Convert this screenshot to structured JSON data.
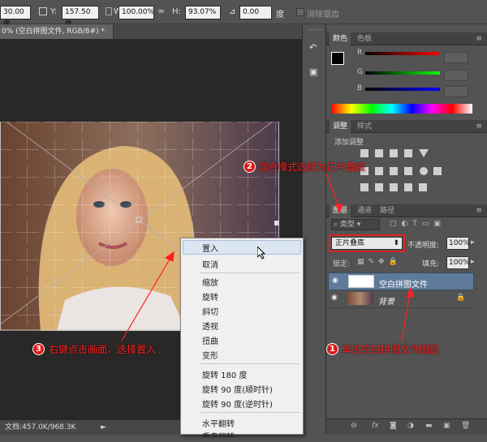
{
  "options_bar": {
    "x_value": "30.00 像",
    "y_label": "Y:",
    "y_value": "157.50 像",
    "w_label": "W:",
    "w_value": "100.00%",
    "h_label": "H:",
    "h_value": "93.07%",
    "angle_value": "0.00",
    "angle_unit": "度",
    "antialias_label": "消除锯齿"
  },
  "document": {
    "tab_title": "0% (空白拼图文件, RGB/8#) *",
    "close_glyph": "×",
    "status_text": "文档:457.0K/968.3K"
  },
  "color_panel": {
    "tabs": [
      "颜色",
      "色板"
    ],
    "channels": [
      "R",
      "G",
      "B"
    ]
  },
  "adjust_panel": {
    "tabs": [
      "调整",
      "样式"
    ],
    "add_label": "添加调整"
  },
  "layers_panel": {
    "tabs": [
      "图层",
      "通道",
      "路径"
    ],
    "kind_label": "类型",
    "blend_mode": "正片叠底",
    "opacity_label": "不透明度:",
    "opacity_value": "100%",
    "lock_label": "锁定:",
    "fill_label": "填充:",
    "fill_value": "100%",
    "layers": [
      {
        "name": "空白拼图文件"
      },
      {
        "name": "背景"
      }
    ]
  },
  "context_menu": {
    "items": [
      "置入",
      "取消",
      "缩放",
      "旋转",
      "斜切",
      "透视",
      "扭曲",
      "变形",
      "旋转 180 度",
      "旋转 90 度(顺时针)",
      "旋转 90 度(逆时针)",
      "水平翻转",
      "垂直翻转"
    ]
  },
  "annotations": {
    "step1_num": "1",
    "step1_text": "单击空白拼图文件图层",
    "step2_num": "2",
    "step2_text": "混合模式选择为正片叠底",
    "step3_num": "3",
    "step3_text": "右键点击画面，选择置入"
  },
  "colors": {
    "annotation": "#ff2020",
    "panel_bg": "#535353",
    "selected_layer": "#5f7a9a"
  },
  "icons": [
    "history-icon",
    "actions-icon",
    "eye-icon",
    "lock-icon",
    "link-icon",
    "fx-icon",
    "mask-icon",
    "adjustment-icon",
    "folder-icon",
    "new-layer-icon",
    "trash-icon"
  ]
}
